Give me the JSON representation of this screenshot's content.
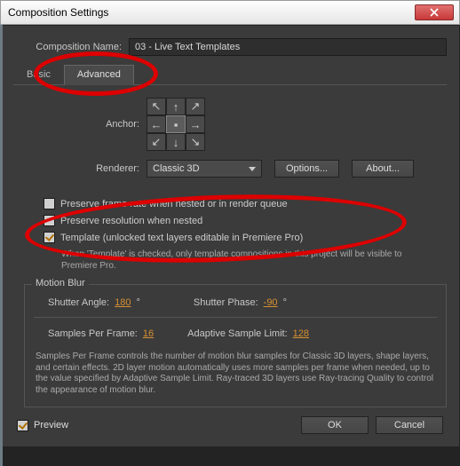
{
  "title": "Composition Settings",
  "compName": {
    "label": "Composition Name:",
    "value": "03 - Live Text Templates"
  },
  "tabs": {
    "basic": "Basic",
    "advanced": "Advanced"
  },
  "anchorLabel": "Anchor:",
  "renderer": {
    "label": "Renderer:",
    "value": "Classic 3D",
    "options": "Options...",
    "about": "About..."
  },
  "checks": {
    "preserveFrame": "Preserve frame rate when nested or in render queue",
    "preserveRes": "Preserve resolution when nested",
    "template": "Template (unlocked text layers editable in Premiere Pro)",
    "templateHelp": "When 'Template' is checked, only template compositions in this project will be visible to Premiere Pro."
  },
  "motionBlur": {
    "title": "Motion Blur",
    "shutterAngle": {
      "label": "Shutter Angle:",
      "value": "180",
      "suffix": "°"
    },
    "shutterPhase": {
      "label": "Shutter Phase:",
      "value": "-90",
      "suffix": "°"
    },
    "samples": {
      "label": "Samples Per Frame:",
      "value": "16"
    },
    "adaptive": {
      "label": "Adaptive Sample Limit:",
      "value": "128"
    },
    "help": "Samples Per Frame controls the number of motion blur samples for Classic 3D layers, shape layers, and certain effects. 2D layer motion automatically uses more samples per frame when needed, up to the value specified by Adaptive Sample Limit. Ray-traced 3D layers use Ray-tracing Quality to control the appearance of motion blur."
  },
  "footer": {
    "preview": "Preview",
    "ok": "OK",
    "cancel": "Cancel"
  }
}
